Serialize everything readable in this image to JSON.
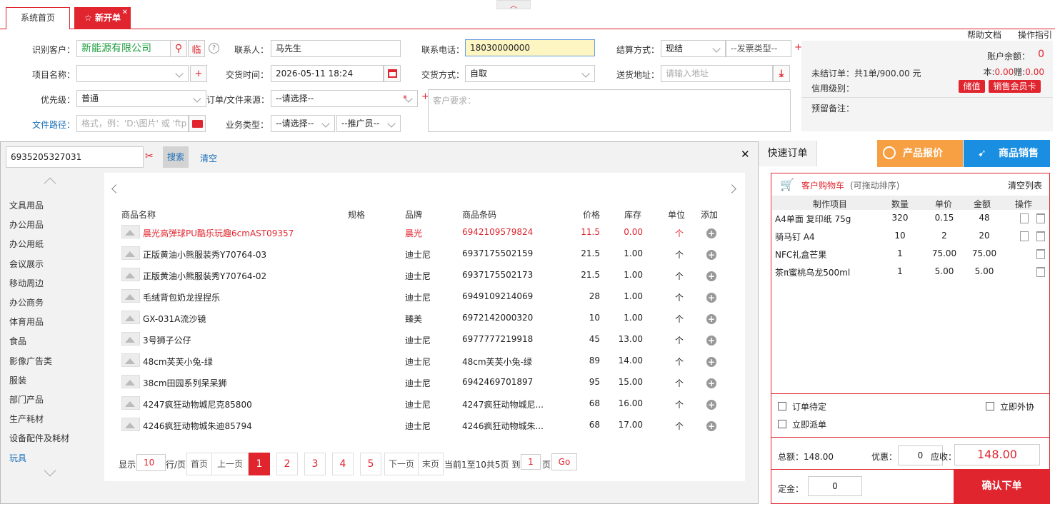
{
  "tabs": {
    "home": "系统首页",
    "new": "新开单",
    "close": "✕",
    "collapse": "︿"
  },
  "topright": {
    "help": "帮助文档",
    "guide": "操作指引"
  },
  "form": {
    "customer_label": "识别客户：",
    "customer_value": "新能源有限公司",
    "temp_label": "临",
    "help_q": "?",
    "contact_label": "联系人：",
    "contact_value": "马先生",
    "phone_label": "联系电话：",
    "phone_value": "18030000000",
    "settle_label": "结算方式：",
    "settle_value": "现结",
    "invoice_value": "--发票类型--",
    "plus": "+",
    "project_label": "项目名称：",
    "delivery_time_label": "交货时间：",
    "delivery_time_value": "2026-05-11 18:24",
    "delivery_mode_label": "交货方式：",
    "delivery_mode_value": "自取",
    "address_label": "送货地址：",
    "address_placeholder": "请输入地址",
    "priority_label": "优先级：",
    "priority_value": "普通",
    "source_label": "订单/文件来源：",
    "source_value": "--请选择--",
    "star": "*",
    "request_placeholder": "客户要求：",
    "filepath_label": "文件路径：",
    "filepath_placeholder": "格式，例：'D:\\图片' 或 'ftp",
    "biz_label": "业务类型：",
    "biz_value": "--请选择--",
    "promoter_value": "--推广员--"
  },
  "account": {
    "balance_label": "账户余额：",
    "balance_value": "0",
    "unsettled": "未结订单：共1单/900.00 元",
    "principal_label": "本:",
    "principal_value": "0.00",
    "gift_label": "赠:",
    "gift_value": "0.00",
    "credit_label": "信用级别：",
    "store_btn": "储值",
    "card_btn": "销售会员卡",
    "note_label": "预留备注："
  },
  "search": {
    "value": "6935205327031",
    "search_btn": "搜索",
    "clear_btn": "清空",
    "close": "✕"
  },
  "categories": [
    "文具用品",
    "办公用品",
    "办公用纸",
    "会议展示",
    "移动周边",
    "办公商务",
    "体育用品",
    "食品",
    "影像广告类",
    "服装",
    "部门产品",
    "生产耗材",
    "设备配件及耗材",
    "玩具"
  ],
  "table": {
    "headers": [
      "商品名称",
      "规格",
      "品牌",
      "商品条码",
      "价格",
      "库存",
      "单位",
      "添加"
    ],
    "rows": [
      {
        "name": "晨光高弹球PU酷乐玩趣6cmAST09357",
        "spec": "",
        "brand": "晨光",
        "code": "6942109579824",
        "price": "11.5",
        "stock": "0.00",
        "unit": "个"
      },
      {
        "name": "正版黄油小熊服装秀Y70764-03",
        "spec": "",
        "brand": "迪士尼",
        "code": "6937175502159",
        "price": "21.5",
        "stock": "1.00",
        "unit": "个"
      },
      {
        "name": "正版黄油小熊服装秀Y70764-02",
        "spec": "",
        "brand": "迪士尼",
        "code": "6937175502173",
        "price": "21.5",
        "stock": "1.00",
        "unit": "个"
      },
      {
        "name": "毛绒背包奶龙捏捏乐",
        "spec": "",
        "brand": "迪士尼",
        "code": "6949109214069",
        "price": "28",
        "stock": "1.00",
        "unit": "个"
      },
      {
        "name": "GX-031A流沙镜",
        "spec": "",
        "brand": "臻美",
        "code": "6972142000320",
        "price": "10",
        "stock": "1.00",
        "unit": "个"
      },
      {
        "name": "3号狮子公仔",
        "spec": "",
        "brand": "迪士尼",
        "code": "6977777219918",
        "price": "45",
        "stock": "13.00",
        "unit": "个"
      },
      {
        "name": "48cm芙芙小兔-绿",
        "spec": "",
        "brand": "迪士尼",
        "code": "48cm芙芙小兔-绿",
        "price": "89",
        "stock": "14.00",
        "unit": "个"
      },
      {
        "name": "38cm田园系列呆呆狮",
        "spec": "",
        "brand": "迪士尼",
        "code": "6942469701897",
        "price": "95",
        "stock": "15.00",
        "unit": "个"
      },
      {
        "name": "4247疯狂动物城尼克85800",
        "spec": "",
        "brand": "迪士尼",
        "code": "4247疯狂动物城尼...",
        "price": "68",
        "stock": "16.00",
        "unit": "个"
      },
      {
        "name": "4246疯狂动物城朱迪85794",
        "spec": "",
        "brand": "迪士尼",
        "code": "4246疯狂动物城朱...",
        "price": "68",
        "stock": "17.00",
        "unit": "个"
      }
    ]
  },
  "pager": {
    "show": "显示",
    "per_value": "10",
    "per_suffix": "行/页",
    "first": "首页",
    "prev": "上一页",
    "pages": [
      "1",
      "2",
      "3",
      "4",
      "5"
    ],
    "next": "下一页",
    "last": "末页",
    "info": "当前1至10共5页 到",
    "goto_value": "1",
    "page_suffix": "页",
    "go": "Go"
  },
  "right_tabs": {
    "quick": "快速订单",
    "quote": "产品报价",
    "sale": "商品销售"
  },
  "cart": {
    "title": "客户购物车",
    "hint": "(可拖动排序)",
    "clear": "清空列表",
    "headers": [
      "制作项目",
      "数量",
      "单价",
      "金额",
      "操作"
    ],
    "items": [
      {
        "name": "A4单面 复印纸 75g",
        "qty": "320",
        "price": "0.15",
        "amount": "48"
      },
      {
        "name": "骑马钉 A4",
        "qty": "10",
        "price": "2",
        "amount": "20"
      },
      {
        "name": "NFC礼盒芒果",
        "qty": "1",
        "price": "75.00",
        "amount": "75.00"
      },
      {
        "name": "茶π蜜桃乌龙500ml",
        "qty": "1",
        "price": "5.00",
        "amount": "5.00"
      }
    ],
    "opt_pending": "订单待定",
    "opt_outsource": "立即外协",
    "opt_dispatch": "立即派单",
    "total_label": "总额：148.00",
    "discount_label": "优惠：",
    "discount_value": "0",
    "receivable_label": "应收：",
    "receivable_value": "148.00",
    "deposit_label": "定金：",
    "deposit_value": "0",
    "confirm": "确认下单"
  },
  "colors": {
    "brand": "#e0252f",
    "quote": "#f7a043",
    "sale": "#1a8ee0",
    "green": "#1e9e3e"
  }
}
